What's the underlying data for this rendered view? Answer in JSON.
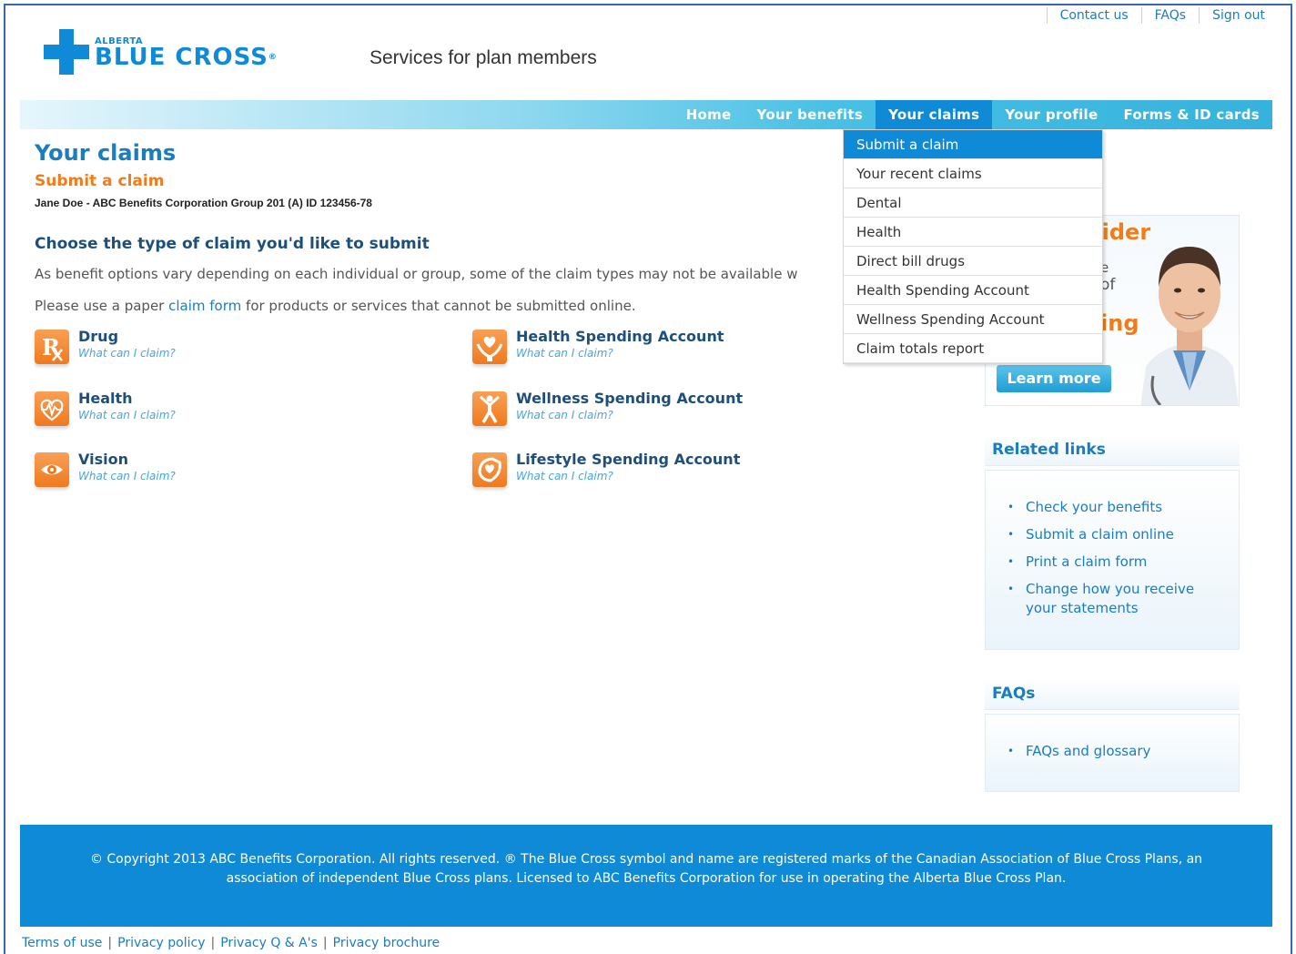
{
  "top_links": [
    "Contact us",
    "FAQs",
    "Sign out"
  ],
  "logo": {
    "province": "ALBERTA",
    "name": "BLUE CROSS",
    "reg": "®"
  },
  "tagline": "Services for plan members",
  "nav": {
    "items": [
      "Home",
      "Your benefits",
      "Your claims",
      "Your profile",
      "Forms & ID cards"
    ],
    "active": "Your claims"
  },
  "dropdown": {
    "items": [
      "Submit a claim",
      "Your recent claims",
      "Dental",
      "Health",
      "Direct bill drugs",
      "Health Spending Account",
      "Wellness Spending Account",
      "Claim totals report"
    ],
    "active": "Submit a claim"
  },
  "page": {
    "title": "Your claims",
    "subtitle": "Submit a claim",
    "member": "Jane Doe - ABC Benefits Corporation Group 201 (A) ID 123456-78",
    "section_heading": "Choose the type of claim you'd like to submit",
    "para1": "As benefit options vary depending on each individual or group, some of the claim types may not be available w",
    "para2_pre": "Please use a paper ",
    "para2_link": "claim form",
    "para2_post": " for products or services that cannot be submitted online."
  },
  "claims": [
    {
      "name": "Drug",
      "link": "What can I claim?",
      "icon": "rx-icon"
    },
    {
      "name": "Health",
      "link": "What can I claim?",
      "icon": "heart-icon"
    },
    {
      "name": "Vision",
      "link": "What can I claim?",
      "icon": "eye-icon"
    },
    {
      "name": "Health Spending Account",
      "link": "What can I claim?",
      "icon": "hands-heart-icon"
    },
    {
      "name": "Wellness Spending Account",
      "link": "What can I claim?",
      "icon": "person-icon"
    },
    {
      "name": "Lifestyle Spending Account",
      "link": "What can I claim?",
      "icon": "lifestyle-icon"
    }
  ],
  "promo": {
    "partial_heading": "vider",
    "partial_line1": "e",
    "partial_line2": "of",
    "partial_heading2": "ing",
    "button": "Learn more"
  },
  "related": {
    "title": "Related links",
    "items": [
      "Check your benefits",
      "Submit a claim online",
      "Print a claim form",
      "Change how you receive your statements"
    ]
  },
  "faqs": {
    "title": "FAQs",
    "items": [
      "FAQs and glossary"
    ]
  },
  "footer": {
    "copyright": "© Copyright 2013 ABC Benefits Corporation. All rights reserved. ® The Blue Cross symbol and name are registered marks of the Canadian Association of Blue Cross Plans, an association of independent Blue Cross plans. Licensed to ABC Benefits Corporation for use in operating the Alberta Blue Cross Plan.",
    "links": [
      "Terms of use",
      "Privacy policy",
      "Privacy Q & A's",
      "Privacy brochure"
    ]
  },
  "colors": {
    "brand_blue": "#0e8ad6",
    "accent_orange": "#f07c1a",
    "heading_navy": "#1d4f7a"
  }
}
